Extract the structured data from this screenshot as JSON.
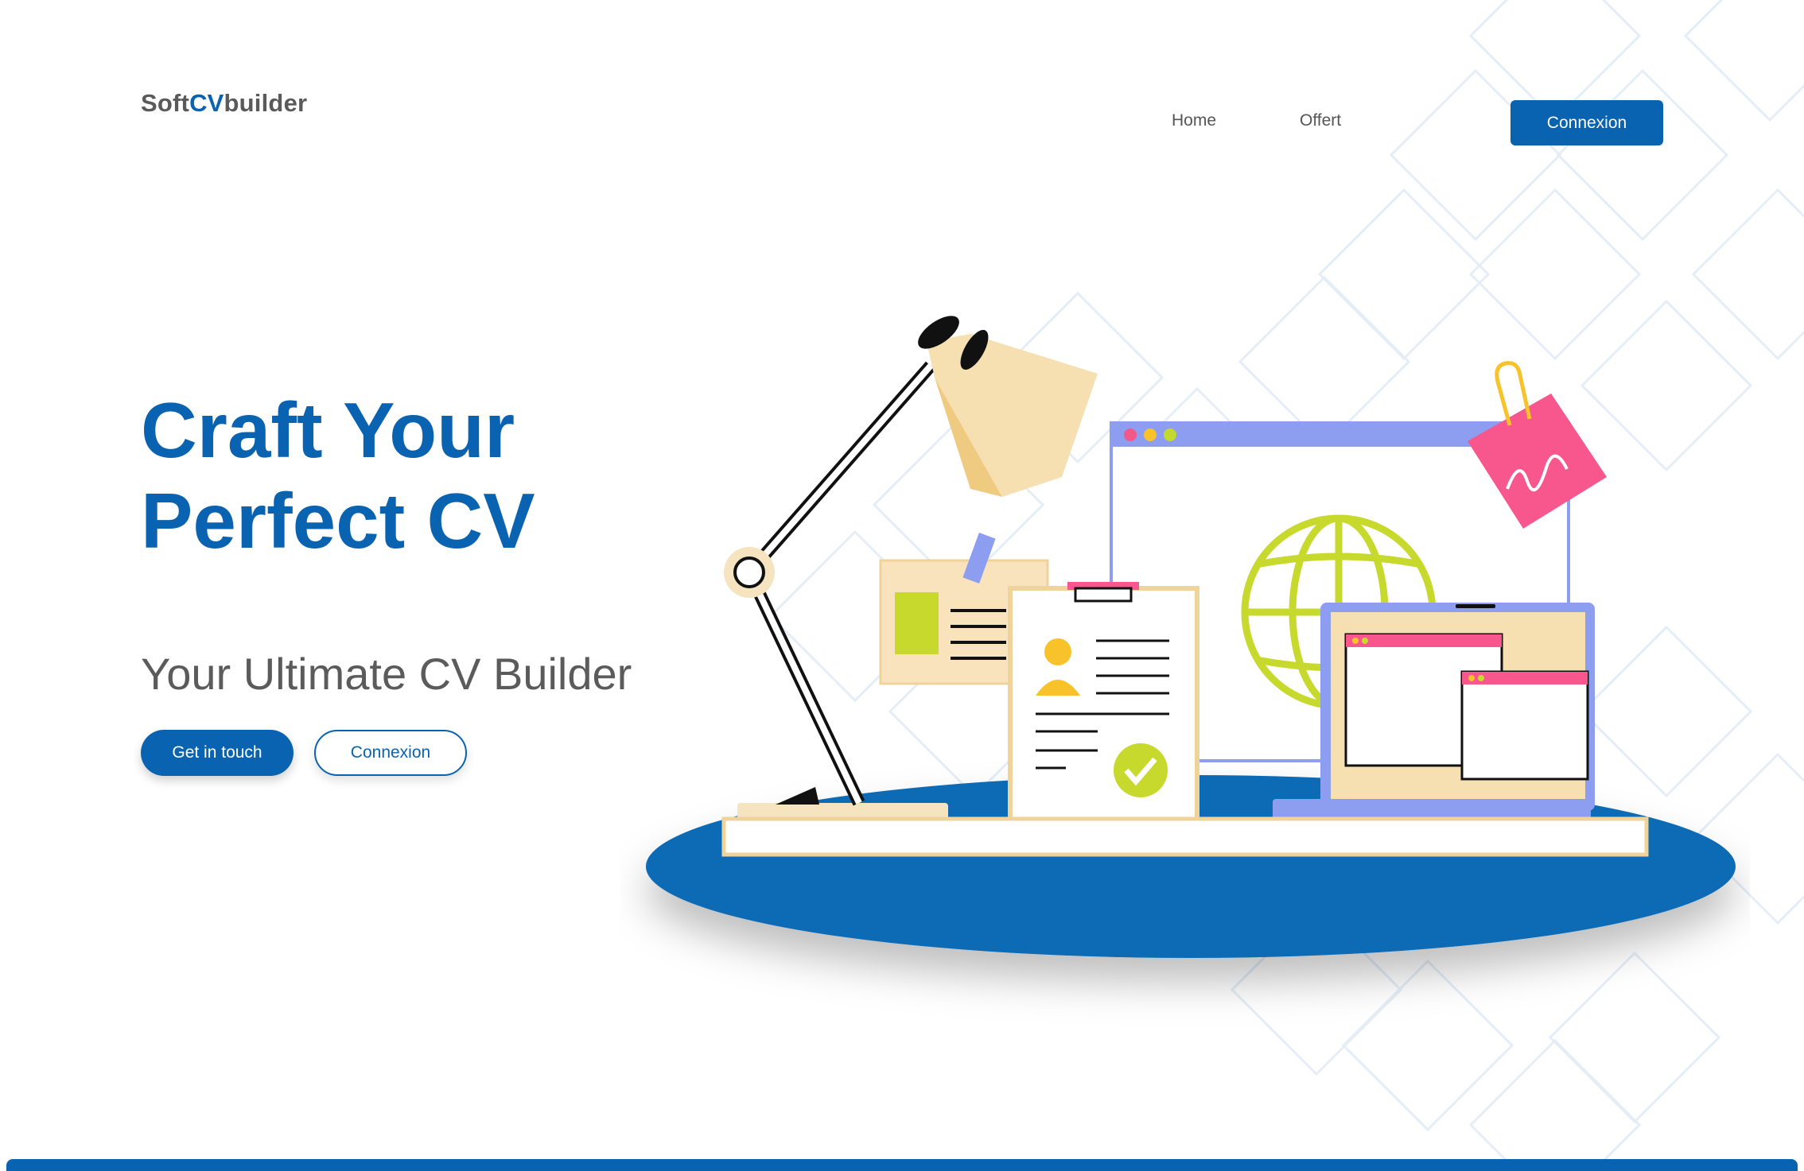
{
  "header": {
    "logo_part1": "Soft",
    "logo_part2": "CV",
    "logo_part3": "builder",
    "nav": {
      "home": "Home",
      "offer": "Offert",
      "cta": "Connexion"
    }
  },
  "hero": {
    "title_line1": "Craft Your",
    "title_line2": "Perfect CV",
    "subtitle": "Your Ultimate CV Builder",
    "primary_button": "Get in touch",
    "secondary_button": "Connexion"
  },
  "colors": {
    "brand": "#0a63b0",
    "text_gray": "#5b5b5b",
    "background": "#ffffff"
  },
  "illustration": {
    "icons": [
      "desk-lamp-icon",
      "globe-icon",
      "clipboard-cv-icon",
      "laptop-icon",
      "sticky-note-icon",
      "paperclip-icon",
      "id-card-icon",
      "checkmark-icon"
    ]
  }
}
